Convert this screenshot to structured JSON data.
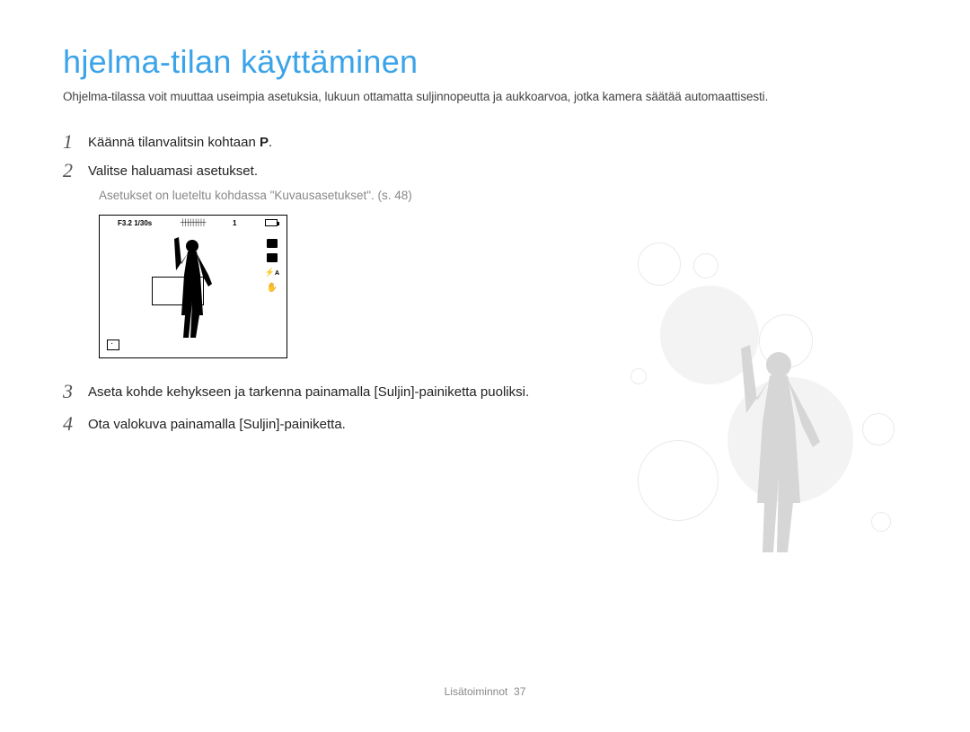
{
  "title": "hjelma-tilan käyttäminen",
  "intro": "Ohjelma-tilassa voit muuttaa useimpia asetuksia, lukuun ottamatta suljinnopeutta ja aukkoarvoa, jotka kamera säätää automaattisesti.",
  "steps": [
    {
      "num": "1",
      "text_before": "Käännä tilanvalitsin kohtaan",
      "symbol": "P",
      "text_after": "."
    },
    {
      "num": "2",
      "text": "Valitse haluamasi asetukset."
    },
    {
      "num": "3",
      "text": "Aseta kohde kehykseen ja tarkenna painamalla [Suljin]-painiketta puoliksi."
    },
    {
      "num": "4",
      "text": "Ota valokuva painamalla [Suljin]-painiketta."
    }
  ],
  "note": "Asetukset on lueteltu kohdassa \"Kuvausasetukset\". (s. 48)",
  "camera_screen": {
    "top_left": "F3.2 1/30s",
    "top_right_num": "1",
    "side_labels": [
      "A"
    ]
  },
  "footer": {
    "section": "Lisätoiminnot",
    "page": "37"
  }
}
